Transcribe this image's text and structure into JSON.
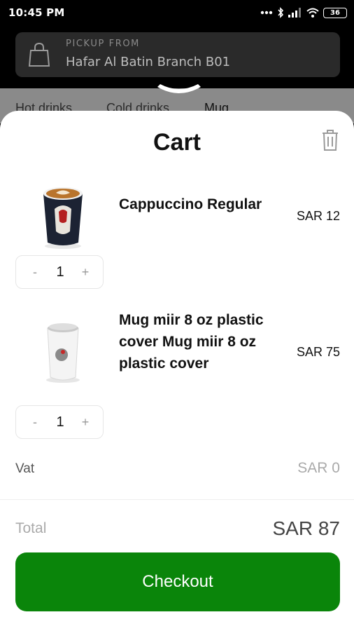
{
  "status_bar": {
    "time": "10:45 PM",
    "battery": "36",
    "icons": [
      "dots-icon",
      "bluetooth-icon",
      "signal-icon",
      "wifi-icon",
      "battery-icon"
    ]
  },
  "header": {
    "pickup_label": "PICKUP FROM",
    "branch_name": "Hafar Al Batin Branch B01",
    "icon": "shopping-bag-icon"
  },
  "category_tabs": [
    {
      "label": "Hot drinks"
    },
    {
      "label": "Cold drinks"
    },
    {
      "label": "Mug"
    }
  ],
  "cart": {
    "title": "Cart",
    "clear_icon": "trash-icon",
    "items": [
      {
        "name": "Cappuccino Regular",
        "price": "SAR 12",
        "quantity": "1",
        "minus": "-",
        "plus": "+"
      },
      {
        "name": "Mug miir 8 oz plastic cover Mug miir 8 oz plastic cover",
        "price": "SAR 75",
        "quantity": "1",
        "minus": "-",
        "plus": "+"
      }
    ],
    "vat_label": "Vat",
    "vat_value": "SAR 0",
    "total_label": "Total",
    "total_value": "SAR 87",
    "checkout_label": "Checkout"
  },
  "colors": {
    "checkout": "#0a850a",
    "header_card": "#2a2a2a"
  }
}
